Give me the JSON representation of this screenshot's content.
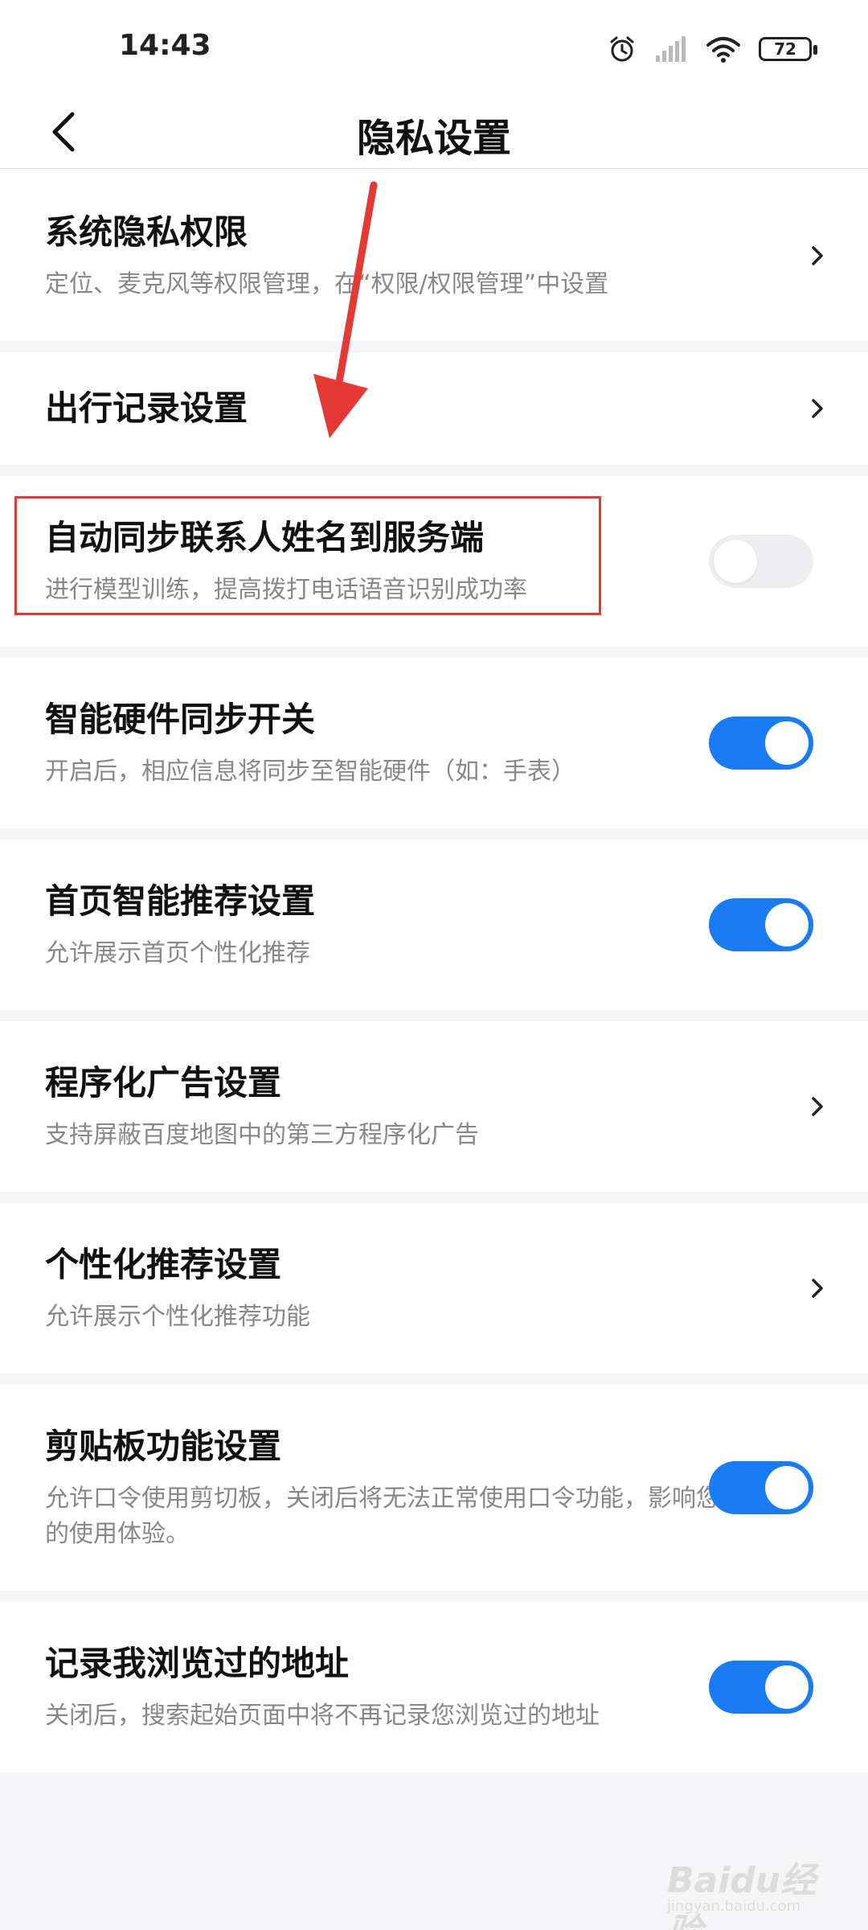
{
  "status_bar": {
    "time": "14:43",
    "battery": "72",
    "icons": [
      "alarm-icon",
      "signal-icon",
      "wifi-icon",
      "battery-icon"
    ]
  },
  "header": {
    "title": "隐私设置"
  },
  "settings": [
    {
      "title": "系统隐私权限",
      "desc": "定位、麦克风等权限管理，在“权限/权限管理”中设置",
      "control": "chevron"
    },
    {
      "title": "出行记录设置",
      "desc": "",
      "control": "chevron"
    },
    {
      "title": "自动同步联系人姓名到服务端",
      "desc": "进行模型训练，提高拨打电话语音识别成功率",
      "control": "toggle",
      "enabled": false
    },
    {
      "title": "智能硬件同步开关",
      "desc": "开启后，相应信息将同步至智能硬件（如：手表）",
      "control": "toggle",
      "enabled": true
    },
    {
      "title": "首页智能推荐设置",
      "desc": "允许展示首页个性化推荐",
      "control": "toggle",
      "enabled": true
    },
    {
      "title": "程序化广告设置",
      "desc": "支持屏蔽百度地图中的第三方程序化广告",
      "control": "chevron"
    },
    {
      "title": "个性化推荐设置",
      "desc": "允许展示个性化推荐功能",
      "control": "chevron"
    },
    {
      "title": "剪贴板功能设置",
      "desc": "允许口令使用剪切板，关闭后将无法正常使用口令功能，影响您的使用体验。",
      "control": "toggle",
      "enabled": true
    },
    {
      "title": "记录我浏览过的地址",
      "desc": "关闭后，搜索起始页面中将不再记录您浏览过的地址",
      "control": "toggle",
      "enabled": true
    }
  ],
  "watermark": {
    "brand": "Baidu经验",
    "url": "jingyan.baidu.com"
  },
  "colors": {
    "accent": "#1a7cf5",
    "annotation": "#e53935"
  }
}
